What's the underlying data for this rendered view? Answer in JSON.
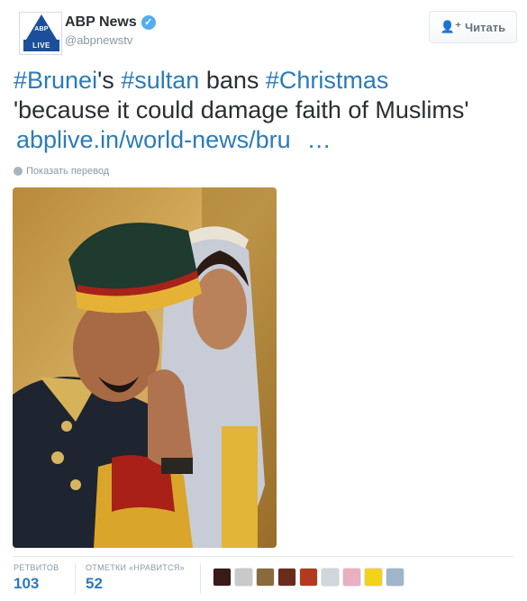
{
  "account": {
    "fullname": "ABP News",
    "username": "@abpnewstv",
    "avatar": {
      "top_text": "ABP",
      "bottom_text": "LIVE",
      "brand_color": "#1b4f99"
    },
    "verified_icon": "check-badge"
  },
  "follow_button": {
    "label": "Читать",
    "icon": "person-plus-icon"
  },
  "tweet": {
    "line1": [
      {
        "type": "hashtag",
        "text": "#Brunei"
      },
      {
        "type": "text",
        "text": "'s "
      },
      {
        "type": "hashtag",
        "text": "#sultan"
      },
      {
        "type": "text",
        "text": " bans "
      },
      {
        "type": "hashtag",
        "text": "#Christmas"
      }
    ],
    "line2": "'because it could damage faith of Muslims'",
    "link": "abplive.in/world-news/bru",
    "ellipsis": "…"
  },
  "translate_label": "Показать перевод",
  "stats": {
    "retweets_label": "РЕТВИТОВ",
    "retweets_value": "103",
    "likes_label": "ОТМЕТКИ «НРАВИТСЯ»",
    "likes_value": "52"
  },
  "liker_colors": [
    "#3a1a1a",
    "#c9c9c9",
    "#8a6a3a",
    "#6b2b1b",
    "#b23a1e",
    "#d0d6dc",
    "#e8b0c0",
    "#f2d21a",
    "#9fb6c8"
  ],
  "colors": {
    "link": "#2b7bb9",
    "muted": "#8899a6",
    "text": "#292f33"
  }
}
